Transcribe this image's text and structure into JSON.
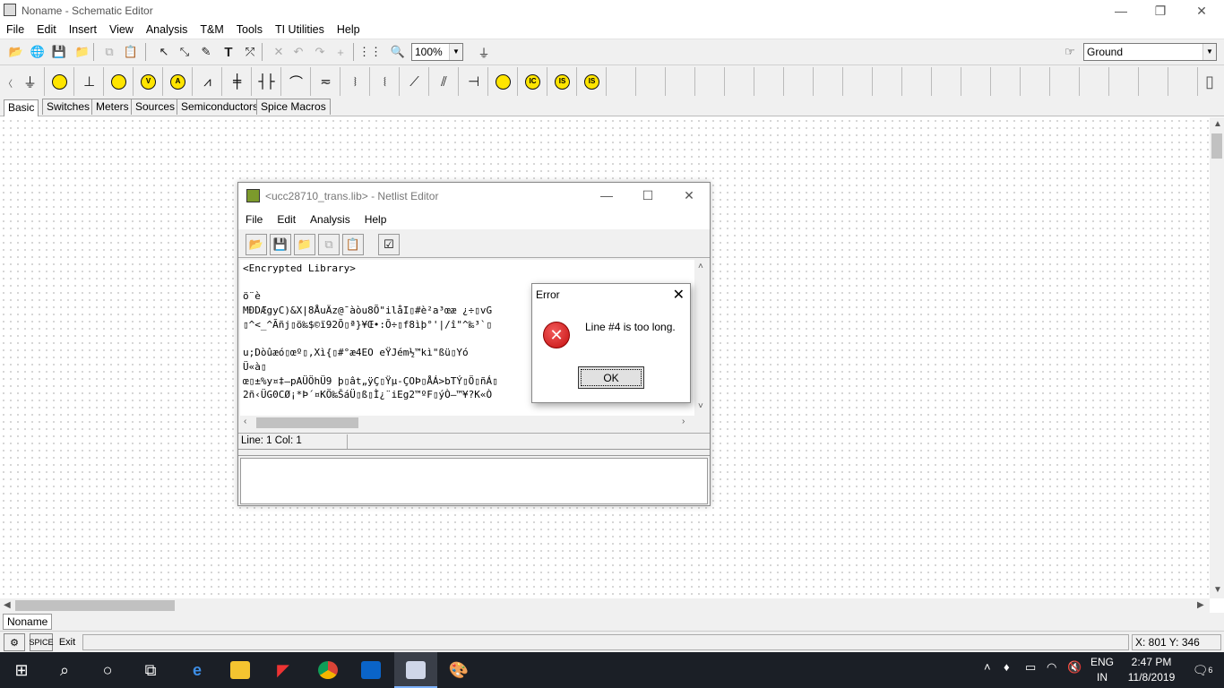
{
  "window": {
    "title": "Noname - Schematic Editor"
  },
  "menu": [
    "File",
    "Edit",
    "Insert",
    "View",
    "Analysis",
    "T&M",
    "Tools",
    "TI Utilities",
    "Help"
  ],
  "toolbar": {
    "zoom": "100%",
    "ground_select": "Ground"
  },
  "component_tabs": [
    "Basic",
    "Switches",
    "Meters",
    "Sources",
    "Semiconductors",
    "Spice Macros"
  ],
  "parts": [
    "ground-icon",
    "battery-icon",
    "capacitor-icon",
    "voltmeter-icon",
    "ammeter-icon",
    "lamp-icon",
    "resistor-icon",
    "inductor-icon",
    "capacitor-symbol-icon",
    "coil-icon",
    "transformer-icon",
    "relay-icon",
    "switch-icon",
    "pot-icon",
    "meter-icon",
    "probe-icon",
    "current-source-icon",
    "ic-icon",
    "isource-icon"
  ],
  "part_labels": {
    "v": "V",
    "a": "A",
    "ic": "IC",
    "is": "IS"
  },
  "doc_tab": "Noname",
  "status": {
    "coords": "X: 801  Y: 346",
    "exit": "Exit"
  },
  "netlist": {
    "title": "<ucc28710_trans.lib> - Netlist Editor",
    "menu": [
      "File",
      "Edit",
      "Analysis",
      "Help"
    ],
    "lines": [
      "<Encrypted Library>",
      "",
      "ö¨è",
      "MÐDÆgyC)&X|8ÅuÄz@¯àòu8Õ\"ilåI▯#è²a³œæ ¿÷▯vG",
      "▯^<_^Ãñj▯ö‰$©ï92Õ▯ª}¥Œ•:Õ÷▯f8ìþ°'|/î\"^‰³`▯",
      "",
      "u;Dòûæó▯œº▯,Xì{▯#°æ4EO eŸJém½™kì\"ßü▯Yó",
      "Ü«à▯",
      "œ▯±%y¤‡–pAÜÖhÜ9 þ▯ât„ÿÇ▯Ÿµ-ÇOÞ▯ÅÁ>bTÝ▯Ö▯ñÁ▯",
      "2ñ‹ÜG0CØ¡*Þ´¤KÖ‰ŠáÜ▯ß▯Ì¿¨iEg2™ºF▯ýÒ–™¥?K«Ò"
    ],
    "status": "Line: 1 Col: 1"
  },
  "error": {
    "title": "Error",
    "message": "Line #4 is too long.",
    "ok": "OK"
  },
  "taskbar": {
    "lang1": "ENG",
    "lang2": "IN",
    "time": "2:47 PM",
    "date": "11/8/2019",
    "notif_count": "6"
  }
}
